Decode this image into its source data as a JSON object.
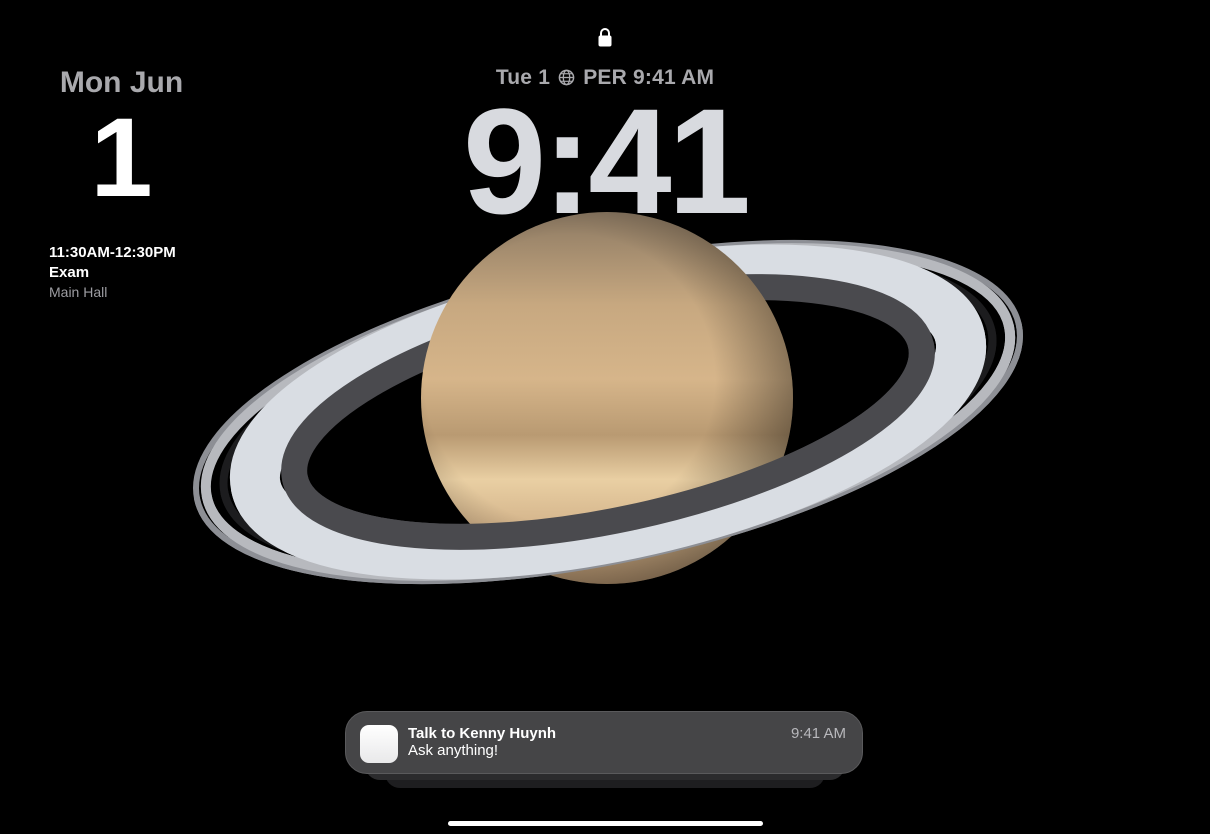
{
  "lock_screen": {
    "date_line": {
      "day": "Tue 1",
      "world_clock": "PER 9:41 AM"
    },
    "time": "9:41"
  },
  "calendar_widget": {
    "month": "Mon Jun",
    "day": "1",
    "event_time": "11:30AM-12:30PM",
    "event_title": "Exam",
    "event_location": "Main Hall"
  },
  "notification": {
    "title": "Talk to Kenny Huynh",
    "body": "Ask anything!",
    "time": "9:41 AM"
  },
  "colors": {
    "background": "#000000",
    "notification_bg": "#454547"
  }
}
